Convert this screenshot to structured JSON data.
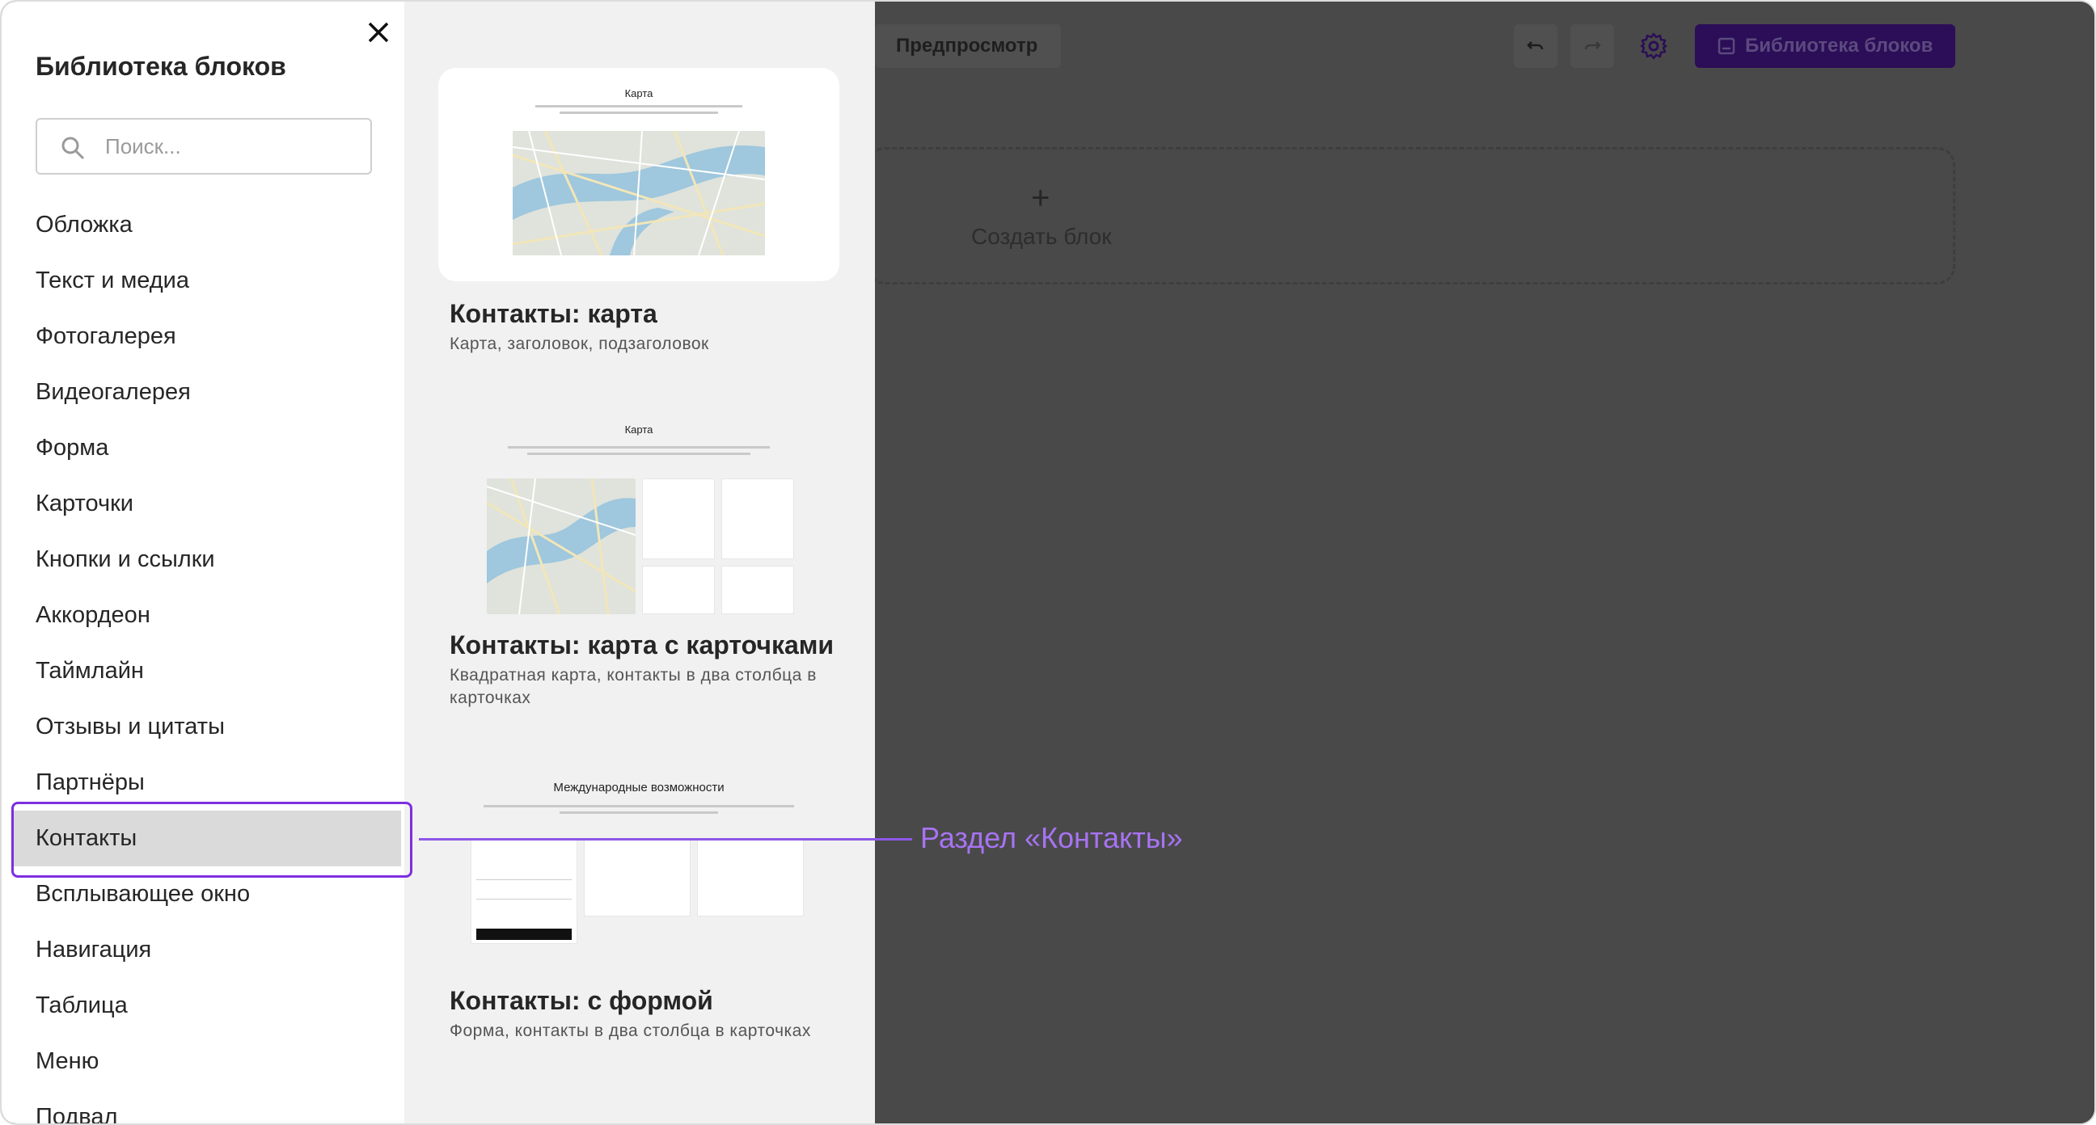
{
  "sidebar": {
    "title": "Библиотека блоков",
    "search_placeholder": "Поиск...",
    "items": [
      {
        "label": "Обложка"
      },
      {
        "label": "Текст и медиа"
      },
      {
        "label": "Фотогалерея"
      },
      {
        "label": "Видеогалерея"
      },
      {
        "label": "Форма"
      },
      {
        "label": "Карточки"
      },
      {
        "label": "Кнопки и ссылки"
      },
      {
        "label": "Аккордеон"
      },
      {
        "label": "Таймлайн"
      },
      {
        "label": "Отзывы и цитаты"
      },
      {
        "label": "Партнёры"
      },
      {
        "label": "Контакты",
        "active": true
      },
      {
        "label": "Всплывающее окно"
      },
      {
        "label": "Навигация"
      },
      {
        "label": "Таблица"
      },
      {
        "label": "Меню"
      },
      {
        "label": "Подвал"
      }
    ]
  },
  "gallery": {
    "blocks": [
      {
        "preview_heading": "Карта",
        "title": "Контакты: карта",
        "description": "Карта, заголовок, подзаголовок"
      },
      {
        "preview_heading": "Карта",
        "title": "Контакты: карта с карточками",
        "description": "Квадратная карта, контакты в два столбца в карточках"
      },
      {
        "preview_heading": "Международные возможности",
        "title": "Контакты: с формой",
        "description": "Форма, контакты в два столбца в карточках"
      }
    ]
  },
  "editor": {
    "preview_label": "Предпросмотр",
    "library_button_label": "Библиотека блоков",
    "create_block_label": "Создать блок",
    "create_block_plus": "+"
  },
  "callout": {
    "label": "Раздел «Контакты»"
  },
  "colors": {
    "accent": "#7d2ee0",
    "callout": "#a773f2",
    "overlay": "#494949"
  }
}
